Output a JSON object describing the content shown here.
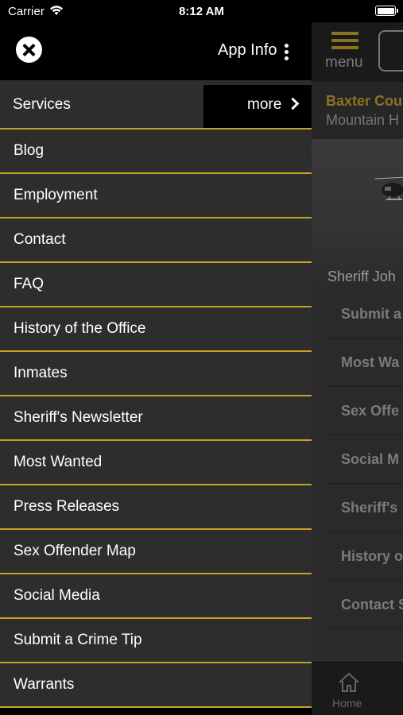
{
  "status_bar": {
    "carrier": "Carrier",
    "time": "8:12 AM"
  },
  "drawer": {
    "app_info_label": "App Info",
    "services_label": "Services",
    "more_label": "more",
    "items": [
      {
        "label": "Blog"
      },
      {
        "label": "Employment"
      },
      {
        "label": "Contact"
      },
      {
        "label": "FAQ"
      },
      {
        "label": "History of the Office"
      },
      {
        "label": "Inmates"
      },
      {
        "label": "Sheriff's Newsletter"
      },
      {
        "label": "Most Wanted"
      },
      {
        "label": "Press Releases"
      },
      {
        "label": "Sex Offender Map"
      },
      {
        "label": "Social Media"
      },
      {
        "label": "Submit a Crime Tip"
      },
      {
        "label": "Warrants"
      }
    ]
  },
  "background_app": {
    "menu_label": "menu",
    "title_line1": "Baxter Cou",
    "title_line2": "Mountain H",
    "hero_caption": "Sheriff Joh",
    "list": [
      {
        "label": "Submit a"
      },
      {
        "label": "Most Wa"
      },
      {
        "label": "Sex Offe"
      },
      {
        "label": "Social M"
      },
      {
        "label": "Sheriff's"
      },
      {
        "label": "History o"
      },
      {
        "label": "Contact S"
      }
    ],
    "tab_home_label": "Home"
  },
  "colors": {
    "accent": "#c7a323",
    "drawer_bg": "#2d2d2d"
  }
}
